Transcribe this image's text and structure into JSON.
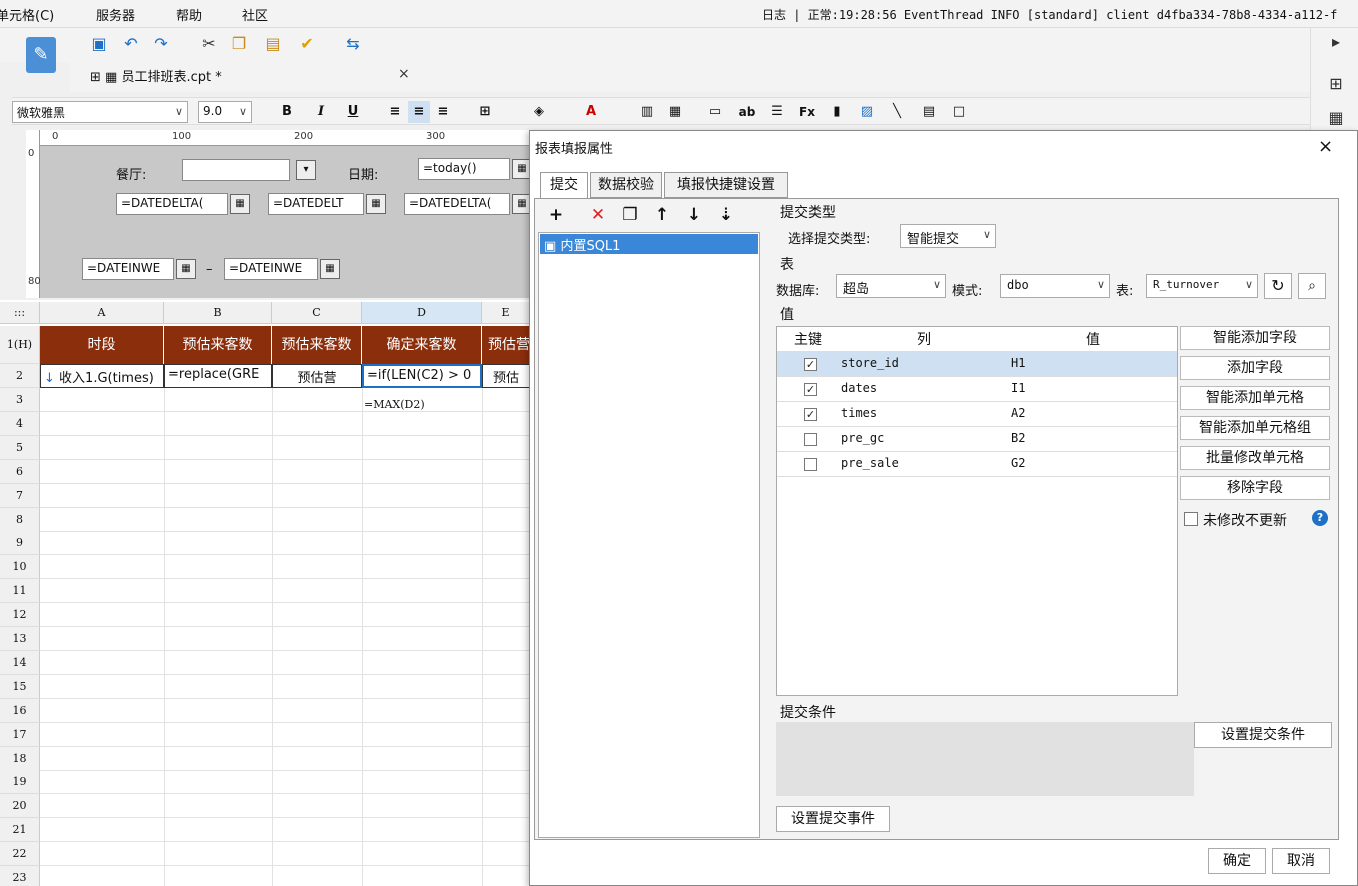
{
  "menubar": {
    "items": [
      "单元格(C)",
      "服务器",
      "帮助",
      "社区"
    ],
    "log": "日志 | 正常:19:28:56 EventThread INFO [standard] client d4fba334-78b8-4334-a112-f"
  },
  "tab": {
    "title": "员工排班表.cpt *",
    "close": "×"
  },
  "format": {
    "font": "微软雅黑",
    "size": "9.0",
    "bold": "B",
    "italic": "I",
    "underline": "U"
  },
  "ruler": {
    "marks": [
      "0",
      "100",
      "200",
      "300"
    ],
    "vmarks": [
      "0",
      "80"
    ]
  },
  "design": {
    "restaurant_label": "餐厅:",
    "restaurant_value": "",
    "date_label": "日期:",
    "date_value": "=today()",
    "datedelta1": "=DATEDELTA(",
    "datedelta2": "=DATEDELT",
    "datedelta3": "=DATEDELTA(",
    "dateinwe1": "=DATEINWE",
    "dash": "–",
    "dateinwe2": "=DATEINWE"
  },
  "grid": {
    "col_letters": [
      "A",
      "B",
      "C",
      "D",
      "E"
    ],
    "row_numbers": [
      "1(H)",
      "2",
      "3",
      "4",
      "5",
      "6",
      "7",
      "8",
      "9",
      "10",
      "11",
      "12",
      "13",
      "14",
      "15",
      "16",
      "17",
      "18",
      "19",
      "20",
      "21",
      "22",
      "23"
    ],
    "headers": [
      "时段",
      "预估来客数",
      "预估来客数",
      "确定来客数",
      "预估营"
    ],
    "row2": [
      "收入1.G(times)",
      "=replace(GRE",
      "预估营",
      "=if(LEN(C2) > 0",
      "预估"
    ],
    "d3": "=MAX(D2)",
    "corner": ":::"
  },
  "dialog": {
    "title": "报表填报属性",
    "close": "×",
    "tabs": [
      "提交",
      "数据校验",
      "填报快捷键设置"
    ],
    "list_item": "内置SQL1",
    "submit_type_section": "提交类型",
    "submit_type_label": "选择提交类型:",
    "submit_type_value": "智能提交",
    "table_section": "表",
    "db_label": "数据库:",
    "db_value": "超岛",
    "schema_label": "模式:",
    "schema_value": "dbo",
    "table_label": "表:",
    "table_value": "R_turnover",
    "value_section": "值",
    "col_headers": [
      "主键",
      "列",
      "值"
    ],
    "rows": [
      {
        "key": true,
        "col": "store_id",
        "val": "H1"
      },
      {
        "key": true,
        "col": "dates",
        "val": "I1"
      },
      {
        "key": true,
        "col": "times",
        "val": "A2"
      },
      {
        "key": false,
        "col": "pre_gc",
        "val": "B2"
      },
      {
        "key": false,
        "col": "pre_sale",
        "val": "G2"
      }
    ],
    "side_buttons": [
      "智能添加字段",
      "添加字段",
      "智能添加单元格",
      "智能添加单元格组",
      "批量修改单元格",
      "移除字段"
    ],
    "no_update_label": "未修改不更新",
    "condition_section": "提交条件",
    "set_condition": "设置提交条件",
    "set_event": "设置提交事件",
    "ok": "确定",
    "cancel": "取消"
  }
}
